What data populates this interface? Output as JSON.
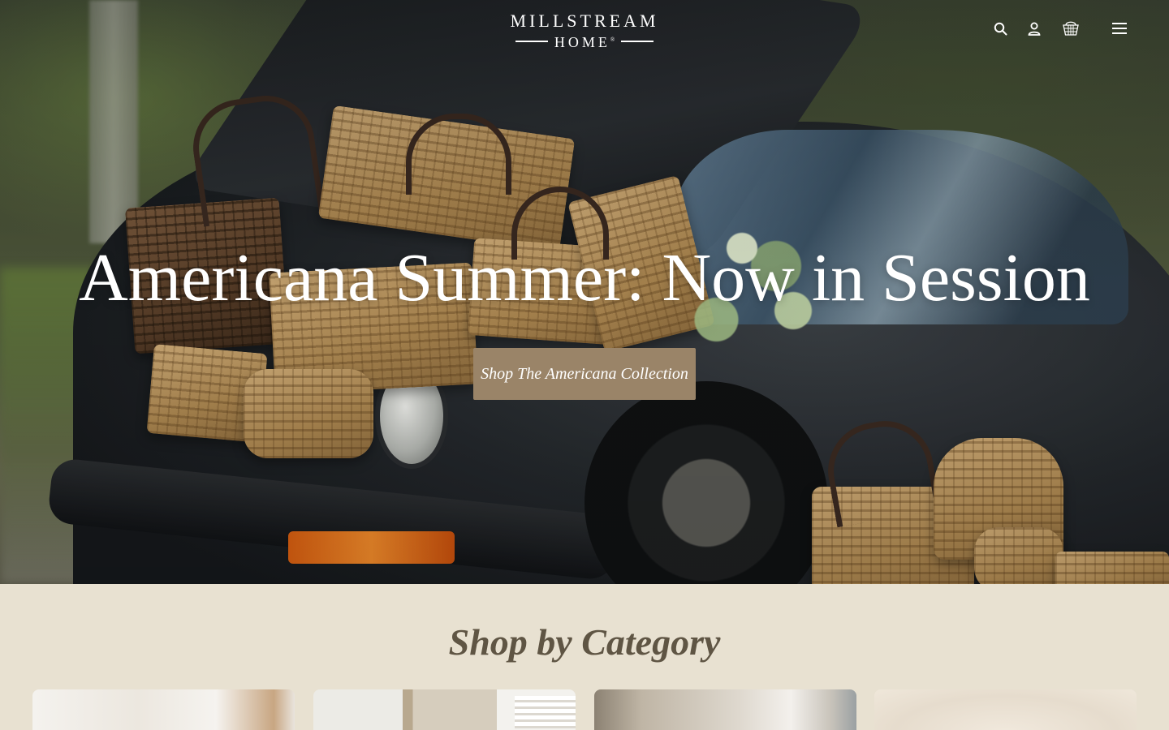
{
  "header": {
    "logo_line1": "MILLSTREAM",
    "logo_line2": "HOME",
    "logo_mark": "®",
    "icons": [
      "search-icon",
      "account-icon",
      "basket-cart-icon",
      "menu-icon"
    ]
  },
  "hero": {
    "title": "Americana Summer: Now in Session",
    "cta_label": "Shop The Americana Collection"
  },
  "categories": {
    "heading": "Shop by Category",
    "cards": [
      {
        "name": "category-card-1"
      },
      {
        "name": "category-card-2"
      },
      {
        "name": "category-card-3"
      },
      {
        "name": "category-card-4"
      }
    ]
  },
  "colors": {
    "cta_background": "#9a8468",
    "page_background": "#e8e1d1",
    "heading_color": "#5f5544"
  }
}
